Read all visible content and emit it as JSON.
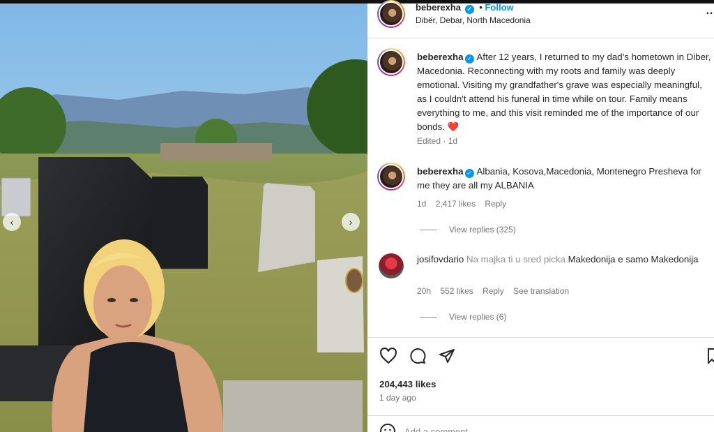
{
  "post": {
    "username": "beberexha",
    "follow_label": "Follow",
    "separator": "•",
    "location": "Dibër, Debar, North Macedonia",
    "more": "…"
  },
  "caption": {
    "username": "beberexha",
    "text": "After 12 years, I returned to my dad's hometown in Diber, Macedonia. Reconnecting with my roots and family was deeply emotional. Visiting my grandfather's grave was especially meaningful, as I couldn't attend his funeral in time while on tour. Family means everything to me, and this visit reminded me of the importance of our bonds.",
    "emoji": "❤️",
    "meta": "Edited · 1d"
  },
  "comments": [
    {
      "username": "beberexha",
      "verified": true,
      "text": "Albania, Kosova,Macedonia, Montenegro Presheva for me they are all my ALBANIA",
      "age": "1d",
      "likes": "2,417 likes",
      "reply": "Reply",
      "view_replies": "View replies (325)"
    },
    {
      "username": "josifovdario",
      "verified": false,
      "text_muted": "Na majka ti u sred picka",
      "text": "Makedonija e samo Makedonija",
      "age": "20h",
      "likes": "552 likes",
      "reply": "Reply",
      "see_translation": "See translation",
      "view_replies": "View replies (6)"
    }
  ],
  "stats": {
    "likes": "204,443 likes",
    "ago": "1 day ago"
  },
  "add_comment_placeholder": "Add a comment...",
  "colors": {
    "accent": "#0095f6",
    "text": "#262626",
    "muted": "#737373"
  },
  "icons": [
    "heart-icon",
    "comment-icon",
    "share-icon",
    "bookmark-icon",
    "verified-icon",
    "emoji-icon",
    "chevron-left-icon",
    "chevron-right-icon"
  ]
}
